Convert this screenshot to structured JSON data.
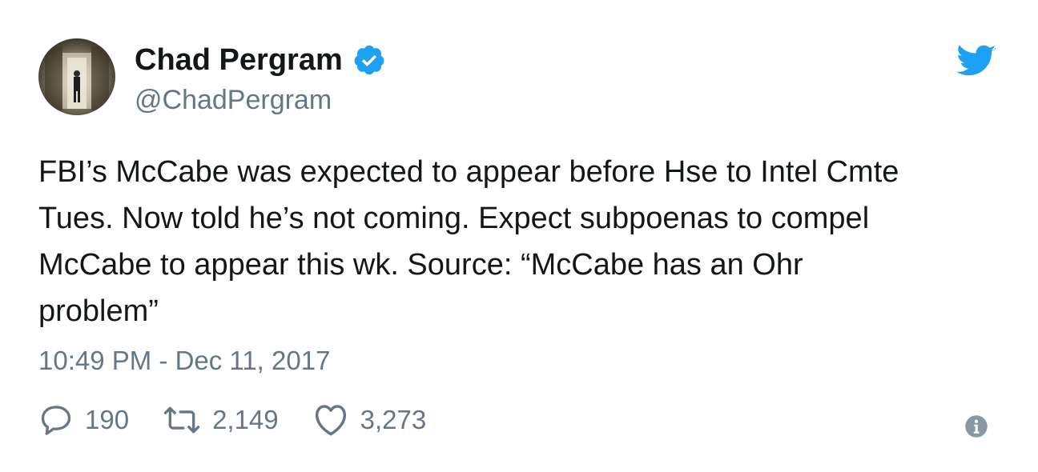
{
  "user": {
    "display_name": "Chad Pergram",
    "handle": "@ChadPergram",
    "verified": true
  },
  "tweet": {
    "text": "FBI’s McCabe was expected to appear before Hse to Intel Cmte\nTues. Now told he’s not coming. Expect subpoenas to compel\nMcCabe to appear this wk. Source: “McCabe has an Ohr\nproblem”",
    "timestamp": "10:49 PM - Dec 11, 2017"
  },
  "actions": {
    "replies": "190",
    "retweets": "2,149",
    "likes": "3,273"
  },
  "icons": {
    "reply": "reply-icon",
    "retweet": "retweet-icon",
    "like": "heart-icon",
    "info": "info-icon",
    "brand": "twitter-bird-icon",
    "verified": "verified-badge-icon"
  },
  "colors": {
    "brand_blue": "#1da1f2",
    "text_primary": "#14171a",
    "text_secondary": "#657786"
  }
}
